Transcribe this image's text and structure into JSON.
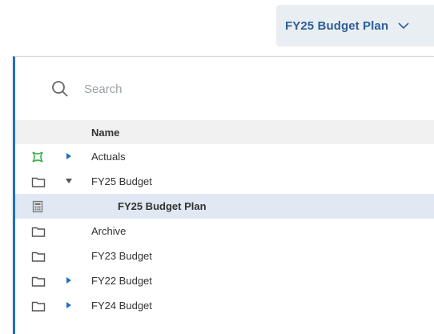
{
  "header": {
    "selector_label": "FY25 Budget Plan",
    "selector_icon": "chevron-down-icon"
  },
  "search": {
    "placeholder": "Search",
    "value": ""
  },
  "list": {
    "column_header": "Name",
    "items": [
      {
        "label": "Actuals",
        "icon": "actuals-module-icon",
        "expander": "collapsed"
      },
      {
        "label": "FY25 Budget",
        "icon": "folder-icon",
        "expander": "expanded"
      },
      {
        "label": "FY25 Budget Plan",
        "icon": "calculator-icon",
        "expander": "none",
        "selected": true
      },
      {
        "label": "Archive",
        "icon": "folder-icon",
        "expander": "none"
      },
      {
        "label": "FY23 Budget",
        "icon": "folder-icon",
        "expander": "none"
      },
      {
        "label": "FY22 Budget",
        "icon": "folder-icon",
        "expander": "collapsed"
      },
      {
        "label": "FY24 Budget",
        "icon": "folder-icon",
        "expander": "collapsed"
      }
    ]
  },
  "colors": {
    "accent": "#1f6fc5",
    "selector_bg": "#e9eef3",
    "selector_text": "#2b5f95",
    "selected_row": "#dfe8f3",
    "header_bg": "#f1f1f1",
    "actuals_icon": "#3ab54a"
  }
}
